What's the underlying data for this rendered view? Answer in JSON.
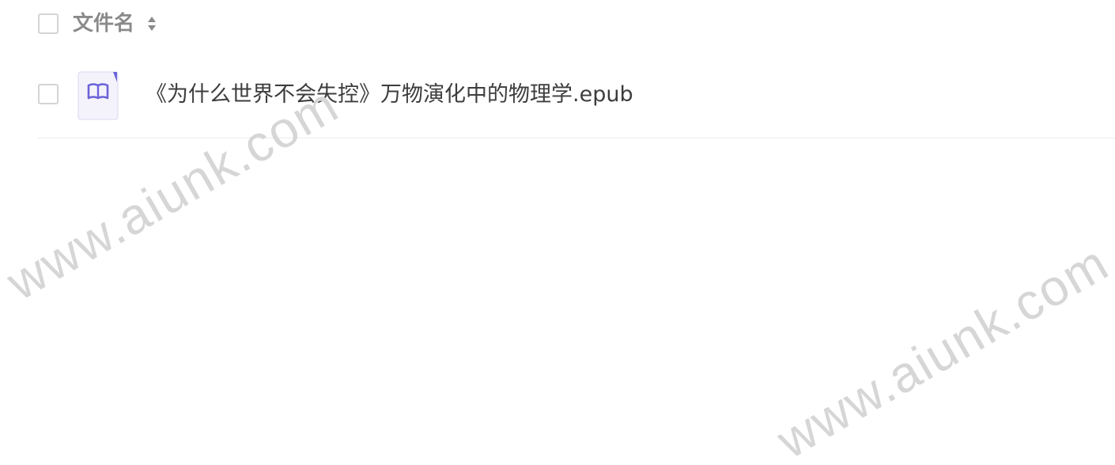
{
  "file_list": {
    "header": {
      "name_column_label": "文件名",
      "sort_icon": "sort-up-down-icon"
    },
    "files": [
      {
        "name": "《为什么世界不会失控》万物演化中的物理学.epub",
        "icon": "epub-book-file-icon",
        "icon_color": "#6c63d8"
      }
    ]
  },
  "watermarks": [
    "www.aiunk.com",
    "www.aiunk.com"
  ]
}
